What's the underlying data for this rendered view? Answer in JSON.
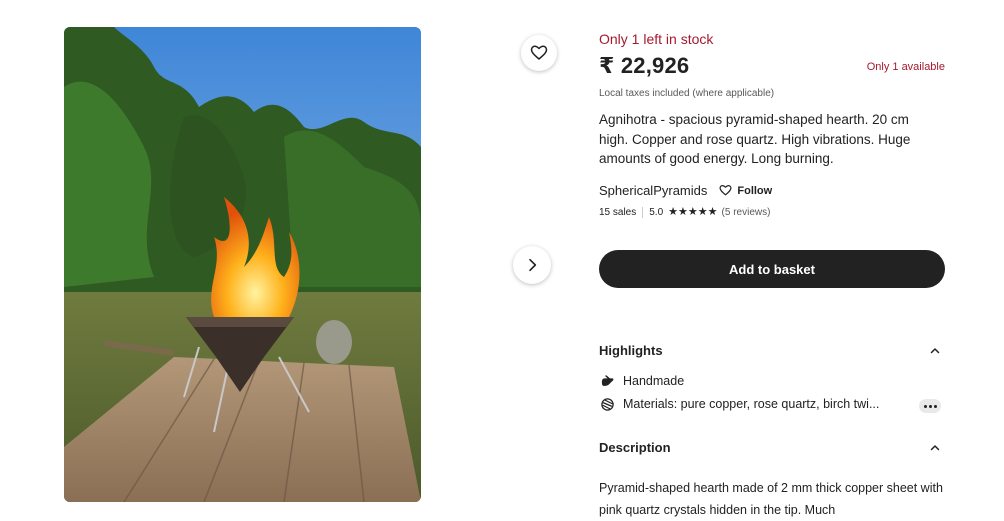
{
  "listing": {
    "stock_notice": "Only 1 left in stock",
    "price": "₹ 22,926",
    "availability": "Only 1 available",
    "taxes_note": "Local taxes included (where applicable)",
    "title": "Agnihotra - spacious pyramid-shaped hearth. 20 cm high. Copper and rose quartz. High vibrations. Huge amounts of good energy. Long burning."
  },
  "shop": {
    "name": "SphericalPyramids",
    "follow_label": "Follow",
    "sales": "15 sales",
    "rating": "5.0",
    "stars": 5,
    "reviews": "(5 reviews)"
  },
  "actions": {
    "add_to_basket": "Add to basket"
  },
  "highlights": {
    "heading": "Highlights",
    "items": [
      {
        "icon": "hand-icon",
        "text": "Handmade"
      },
      {
        "icon": "materials-icon",
        "text": "Materials: pure copper, rose quartz, birch twi..."
      }
    ]
  },
  "description": {
    "heading": "Description",
    "text": "Pyramid-shaped hearth made of 2 mm thick copper sheet with pink quartz crystals hidden in the tip. Much"
  },
  "colors": {
    "accent_red": "#a61a2e",
    "button_dark": "#222222"
  }
}
